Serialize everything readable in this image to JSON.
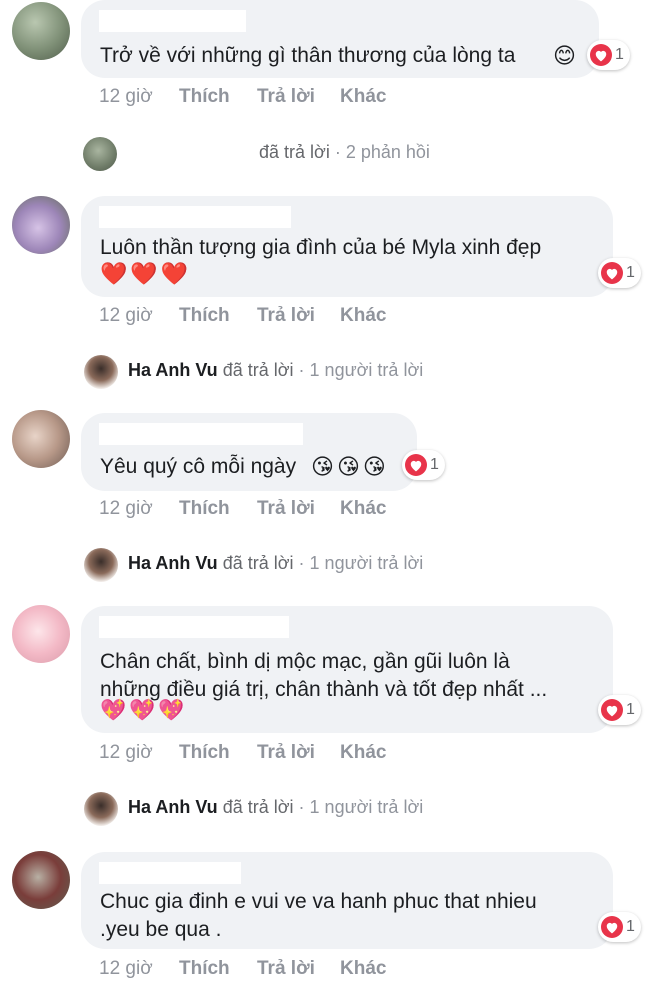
{
  "colors": {
    "bubble_bg": "#f0f2f5",
    "action_text": "#90949c",
    "heart": "#e8344a"
  },
  "actions": {
    "time": "12 giờ",
    "like": "Thích",
    "reply": "Trả lời",
    "more": "Khác"
  },
  "comments": [
    {
      "text_lines": [
        "Trở về với những gì thân thương của lòng ta"
      ],
      "emojis": [
        "😊"
      ],
      "reaction_icon": "heart-icon",
      "reaction_count": "1"
    },
    {
      "text_lines": [
        "Luôn thần tượng gia đình của bé Myla xinh đẹp"
      ],
      "emojis": [
        "❤️",
        "❤️",
        "❤️"
      ],
      "reaction_icon": "heart-icon",
      "reaction_count": "1"
    },
    {
      "text_lines": [
        "Yêu quý cô mỗi ngày"
      ],
      "emojis": [
        "😘",
        "😘",
        "😘"
      ],
      "reaction_icon": "heart-icon",
      "reaction_count": "1"
    },
    {
      "text_lines": [
        "Chân chất, bình dị mộc mạc, gần gũi luôn là",
        "những điều giá trị, chân thành và tốt đẹp nhất ..."
      ],
      "emojis": [
        "💖",
        "💖",
        "💖"
      ],
      "reaction_icon": "heart-icon",
      "reaction_count": "1"
    },
    {
      "text_lines": [
        "Chuc gia đinh e vui ve va hanh phuc that nhieu",
        ".yeu be qua ."
      ],
      "emojis": [],
      "reaction_icon": "heart-icon",
      "reaction_count": "1"
    }
  ],
  "replies": [
    {
      "author": "",
      "verb": "đã trả lời",
      "count": "2 phản hồi"
    },
    {
      "author": "Ha Anh Vu",
      "verb": "đã trả lời",
      "count": "1 người trả lời"
    },
    {
      "author": "Ha Anh Vu",
      "verb": "đã trả lời",
      "count": "1 người trả lời"
    },
    {
      "author": "Ha Anh Vu",
      "verb": "đã trả lời",
      "count": "1 người trả lời"
    }
  ]
}
